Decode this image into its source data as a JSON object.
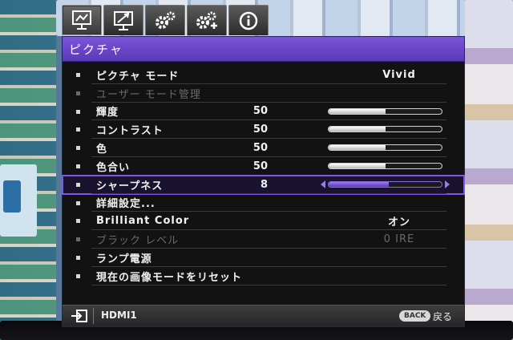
{
  "tabs": [
    {
      "icon": "picture-icon"
    },
    {
      "icon": "picture-advanced-icon"
    },
    {
      "icon": "settings-icon"
    },
    {
      "icon": "system-settings-icon"
    },
    {
      "icon": "info-icon"
    }
  ],
  "menu": {
    "title": "ピクチャ",
    "items": [
      {
        "label": "ピクチャ モード",
        "value": "Vivid"
      },
      {
        "label": "ユーザー モード管理",
        "disabled": true
      },
      {
        "label": "輝度",
        "number": "50",
        "level": 0.5
      },
      {
        "label": "コントラスト",
        "number": "50",
        "level": 0.5
      },
      {
        "label": "色",
        "number": "50",
        "level": 0.5
      },
      {
        "label": "色合い",
        "number": "50",
        "level": 0.5
      },
      {
        "label": "シャープネス",
        "number": "8",
        "level": 0.53,
        "selected": true
      },
      {
        "label": "詳細設定..."
      },
      {
        "label": "Brilliant Color",
        "value": "オン"
      },
      {
        "label": "ブラック レベル",
        "value": "0 IRE",
        "disabled": true
      },
      {
        "label": "ランプ電源"
      },
      {
        "label": "現在の画像モードをリセット"
      }
    ]
  },
  "footer": {
    "source_icon": "input-source-icon",
    "source": "HDMI1",
    "back_button": "BACK",
    "back_label": "戻る"
  },
  "colors": {
    "accent": "#7d57e6",
    "title_bar": "#6a47c8"
  }
}
